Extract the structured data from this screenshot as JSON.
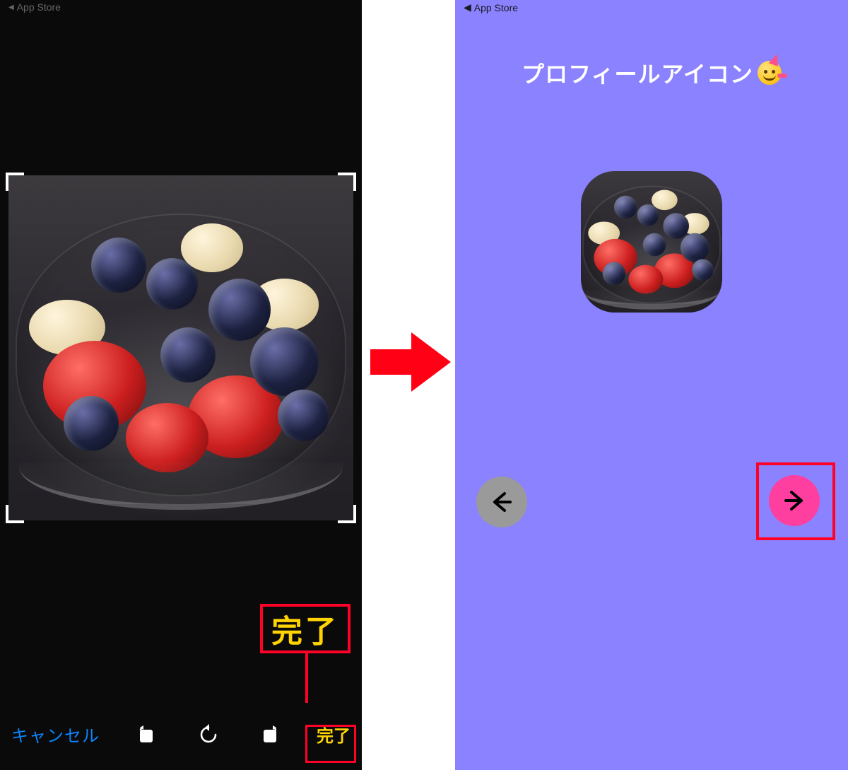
{
  "left": {
    "statusbar_back_label": "App Store",
    "toolbar": {
      "cancel_label": "キャンセル",
      "done_label": "完了",
      "icons": {
        "rotate_left": "rotate-left-icon",
        "undo": "undo-icon",
        "rotate_right": "rotate-right-icon"
      }
    },
    "annotation": {
      "done_pop_label": "完了"
    }
  },
  "arrow": {
    "semantic": "next-step-arrow"
  },
  "right": {
    "statusbar_back_label": "App Store",
    "title": "プロフィールアイコン",
    "title_emoji": "party-face",
    "nav": {
      "back": "back",
      "next": "next"
    }
  },
  "image": {
    "subject": "fruit bowl with strawberries, blueberries, and banana slices in a clear plastic cup"
  },
  "colors": {
    "ios_blue": "#0a84ff",
    "ios_yellow": "#ffd400",
    "right_bg": "#8a82ff",
    "pink_accent": "#ff3fa0",
    "highlight_red": "#ff0026"
  }
}
